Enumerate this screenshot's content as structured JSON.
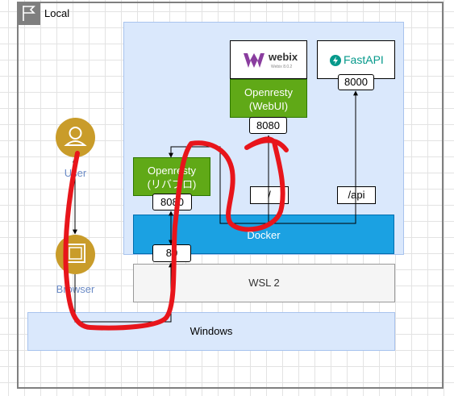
{
  "frame": {
    "label": "Local",
    "icon": "flag-icon"
  },
  "actors": {
    "user": {
      "label": "User",
      "icon": "user-icon"
    },
    "browser": {
      "label": "Browser",
      "icon": "browser-icon"
    }
  },
  "nodes": {
    "webix": {
      "logo_text": "webix",
      "logo_subtext": "Webix 8.0.2",
      "icon": "webix-logo-icon"
    },
    "fastapi": {
      "logo_text": "FastAPI",
      "icon": "fastapi-logo-icon"
    },
    "openresty_webui": {
      "line1": "Openresty",
      "line2": "(WebUI)",
      "port": "8080"
    },
    "openresty_proxy": {
      "line1": "Openresty",
      "line2": "(リバプロ)",
      "port": "8080"
    },
    "fastapi_port": "8000",
    "docker": {
      "label": "Docker",
      "port": "80"
    },
    "wsl": {
      "label": "WSL 2"
    },
    "windows": {
      "label": "Windows"
    }
  },
  "routes": {
    "root": "/",
    "api": "/api"
  },
  "colors": {
    "container": "#dae8fc",
    "openresty": "#60a917",
    "docker": "#1ba1e2",
    "actor": "#c99c2a",
    "annotation": "#e8151b"
  }
}
